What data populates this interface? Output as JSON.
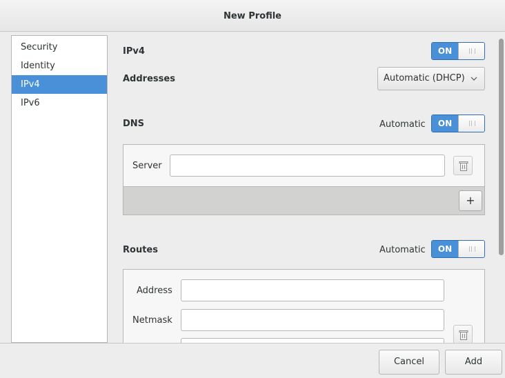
{
  "window": {
    "title": "New Profile"
  },
  "sidebar": {
    "items": [
      {
        "label": "Security",
        "selected": false
      },
      {
        "label": "Identity",
        "selected": false
      },
      {
        "label": "IPv4",
        "selected": true
      },
      {
        "label": "IPv6",
        "selected": false
      }
    ]
  },
  "ipv4": {
    "heading": "IPv4",
    "toggle_label": "ON",
    "addresses_label": "Addresses",
    "addresses_value": "Automatic (DHCP)"
  },
  "dns": {
    "heading": "DNS",
    "auto_label": "Automatic",
    "toggle_label": "ON",
    "server_label": "Server",
    "server_value": "",
    "add_label": "+"
  },
  "routes": {
    "heading": "Routes",
    "auto_label": "Automatic",
    "toggle_label": "ON",
    "address_label": "Address",
    "address_value": "",
    "netmask_label": "Netmask",
    "netmask_value": "",
    "gateway_value": ""
  },
  "footer": {
    "cancel_label": "Cancel",
    "add_label": "Add"
  },
  "colors": {
    "accent": "#4a90d9",
    "window_bg": "#ededed"
  }
}
